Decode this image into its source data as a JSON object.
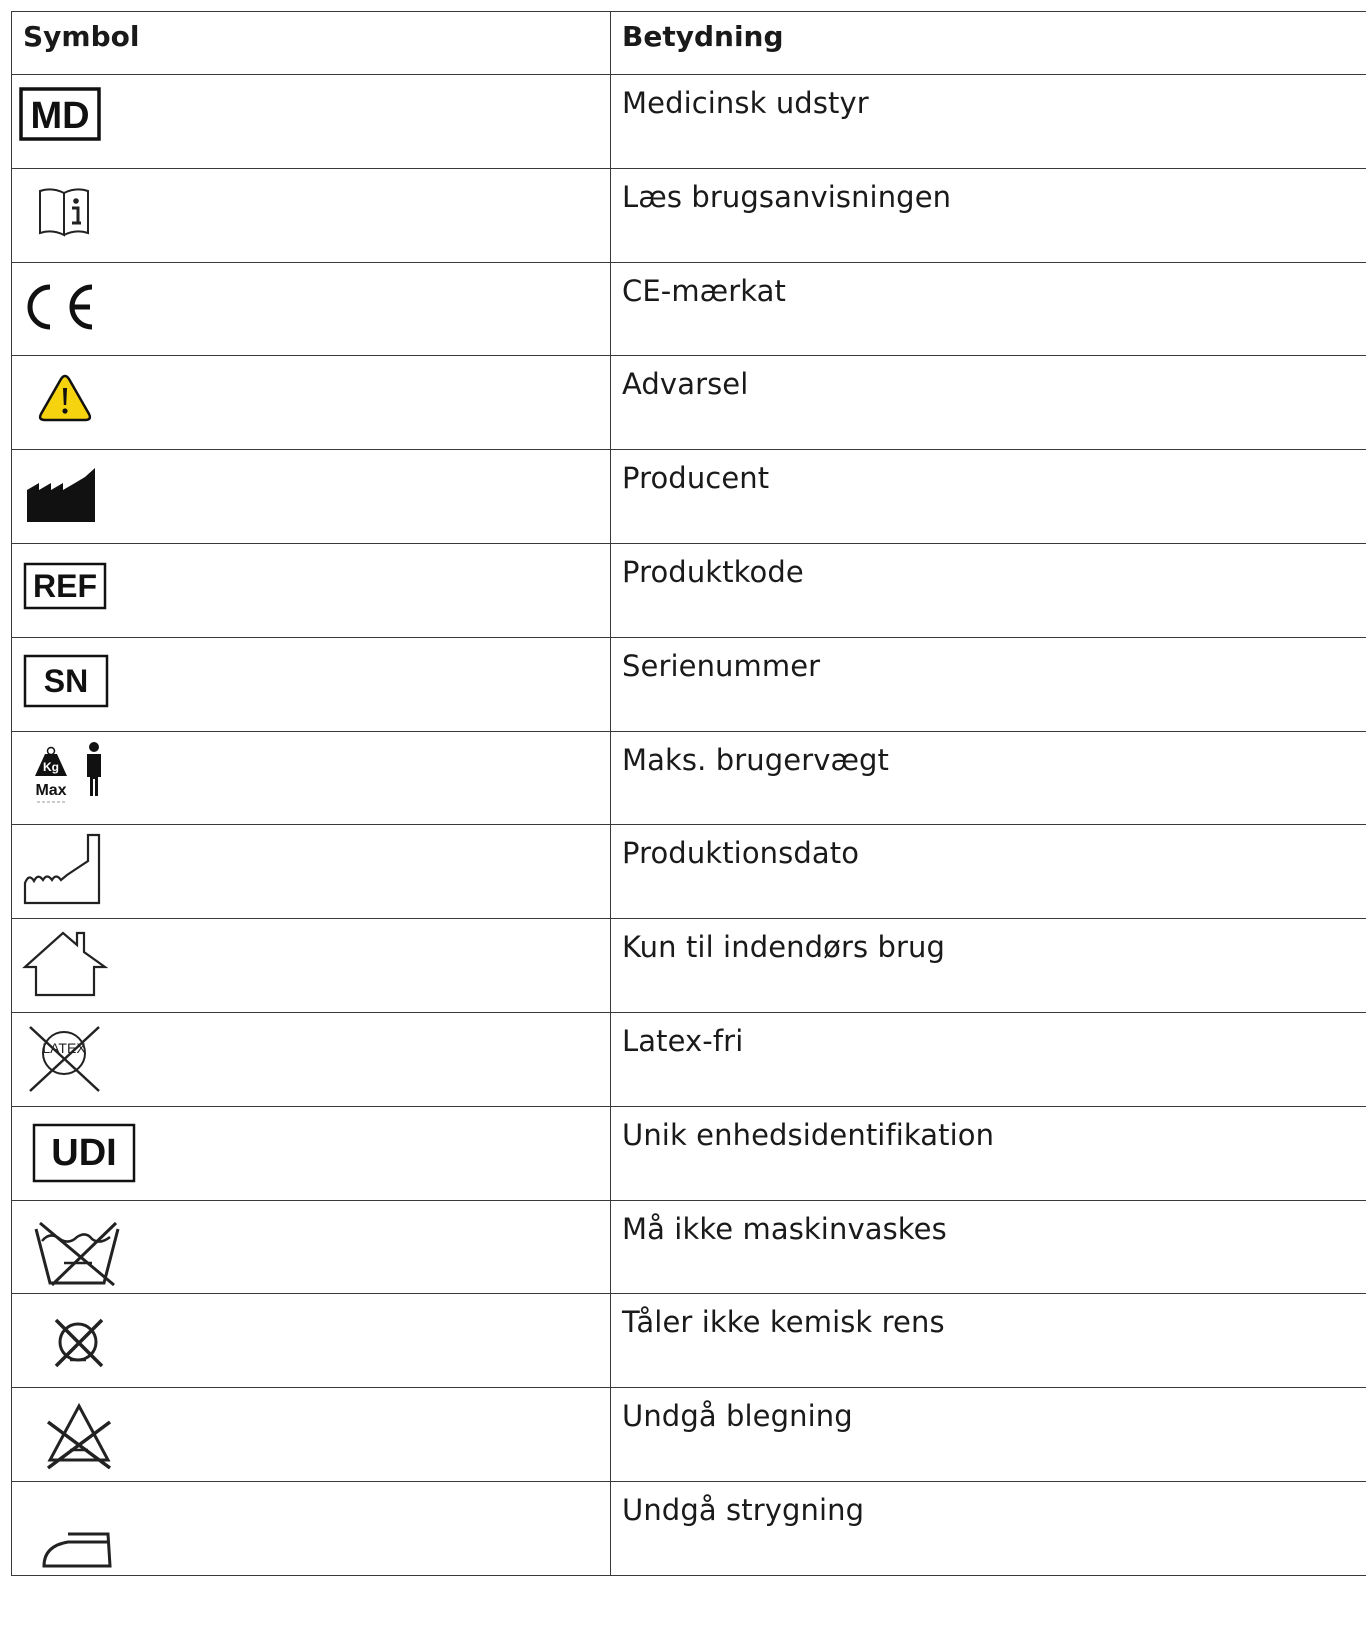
{
  "header": {
    "symbol": "Symbol",
    "meaning": "Betydning"
  },
  "rows": [
    {
      "icon": "medical-device-icon",
      "symbol_text": "MD",
      "meaning": "Medicinsk udstyr"
    },
    {
      "icon": "consult-instructions-icon",
      "meaning": "Læs brugsanvisningen"
    },
    {
      "icon": "ce-mark-icon",
      "meaning": "CE-mærkat"
    },
    {
      "icon": "warning-icon",
      "meaning": "Advarsel"
    },
    {
      "icon": "manufacturer-icon",
      "meaning": "Producent"
    },
    {
      "icon": "reference-icon",
      "symbol_text": "REF",
      "meaning": "Produktkode"
    },
    {
      "icon": "serial-number-icon",
      "symbol_text": "SN",
      "meaning": "Serienummer"
    },
    {
      "icon": "max-user-weight-icon",
      "symbol_text": [
        "Kg",
        "Max"
      ],
      "meaning": "Maks. brugervægt"
    },
    {
      "icon": "date-of-manufacture-icon",
      "meaning": "Produktionsdato"
    },
    {
      "icon": "indoor-use-icon",
      "meaning": "Kun til indendørs brug"
    },
    {
      "icon": "latex-free-icon",
      "symbol_text": "LATEX",
      "meaning": "Latex-fri"
    },
    {
      "icon": "udi-icon",
      "symbol_text": "UDI",
      "meaning": "Unik enhedsidentifikation"
    },
    {
      "icon": "do-not-wash-icon",
      "meaning": "Må ikke maskinvaskes"
    },
    {
      "icon": "do-not-dry-clean-icon",
      "meaning": "Tåler ikke kemisk rens"
    },
    {
      "icon": "do-not-bleach-icon",
      "meaning": "Undgå blegning"
    },
    {
      "icon": "do-not-iron-icon",
      "meaning": "Undgå strygning"
    }
  ],
  "colors": {
    "border": "#3a3a3a",
    "warning_yellow": "#f5d40f",
    "text": "#1a1a1a"
  }
}
